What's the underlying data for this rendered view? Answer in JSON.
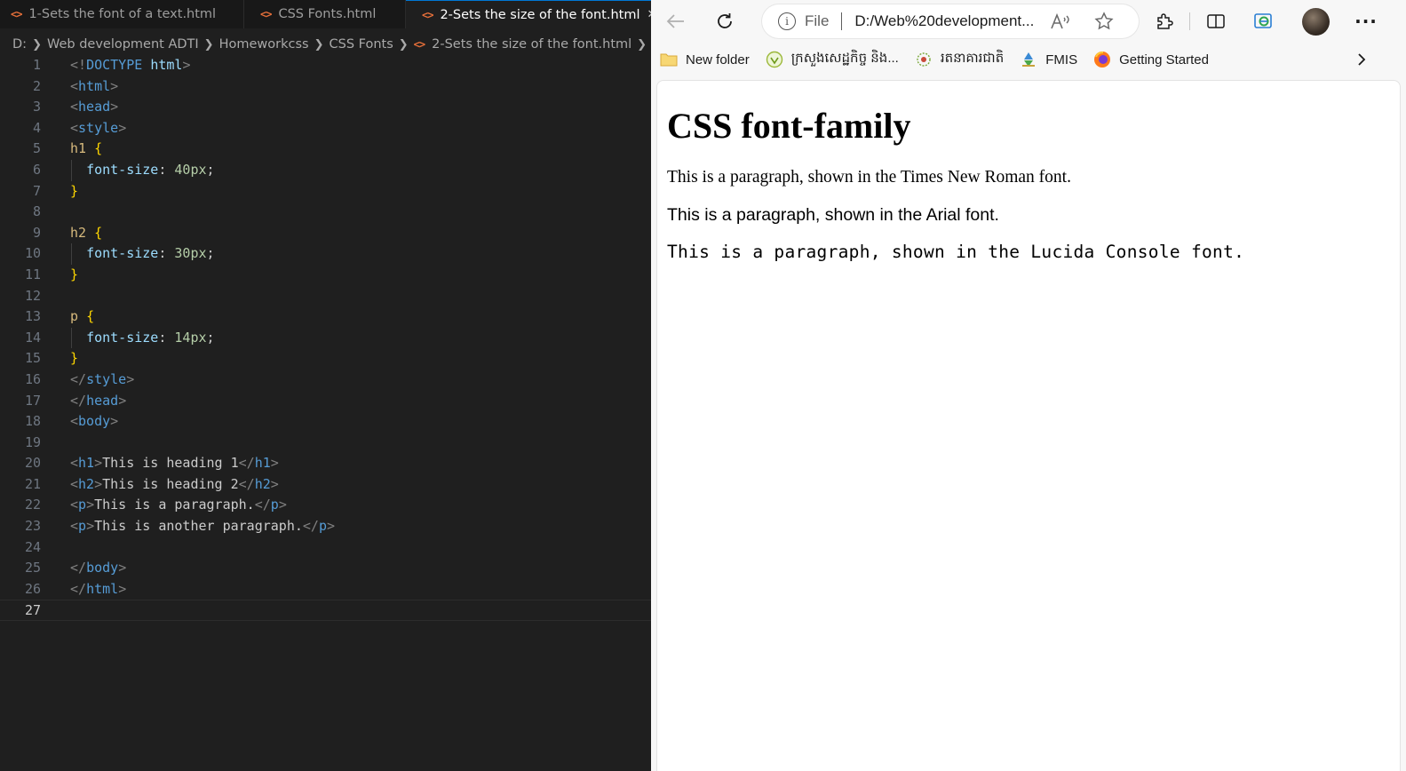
{
  "editor": {
    "tabs": [
      {
        "label": "1-Sets the font of a text.html",
        "icon": "html-file-icon"
      },
      {
        "label": "CSS Fonts.html",
        "icon": "html-file-icon"
      },
      {
        "label": "2-Sets the size of the font.html",
        "icon": "html-file-icon",
        "active": true
      }
    ],
    "breadcrumb": [
      "D:",
      "Web development ADTI",
      "Homeworkcss",
      "CSS Fonts",
      "2-Sets the size of the font.html",
      "..."
    ],
    "current_line": 27,
    "lines": [
      [
        [
          "punc",
          "<!"
        ],
        [
          "tag",
          "DOCTYPE"
        ],
        [
          "text",
          " "
        ],
        [
          "prop",
          "html"
        ],
        [
          "punc",
          ">"
        ]
      ],
      [
        [
          "punc",
          "<"
        ],
        [
          "tag",
          "html"
        ],
        [
          "punc",
          ">"
        ]
      ],
      [
        [
          "punc",
          "<"
        ],
        [
          "tag",
          "head"
        ],
        [
          "punc",
          ">"
        ]
      ],
      [
        [
          "punc",
          "<"
        ],
        [
          "tag",
          "style"
        ],
        [
          "punc",
          ">"
        ]
      ],
      [
        [
          "sel",
          "h1"
        ],
        [
          "text",
          " "
        ],
        [
          "brace",
          "{"
        ]
      ],
      [
        [
          "text",
          "  "
        ],
        [
          "prop",
          "font-size"
        ],
        [
          "text",
          ": "
        ],
        [
          "num",
          "40px"
        ],
        [
          "text",
          ";"
        ]
      ],
      [
        [
          "brace",
          "}"
        ]
      ],
      [],
      [
        [
          "sel",
          "h2"
        ],
        [
          "text",
          " "
        ],
        [
          "brace",
          "{"
        ]
      ],
      [
        [
          "text",
          "  "
        ],
        [
          "prop",
          "font-size"
        ],
        [
          "text",
          ": "
        ],
        [
          "num",
          "30px"
        ],
        [
          "text",
          ";"
        ]
      ],
      [
        [
          "brace",
          "}"
        ]
      ],
      [],
      [
        [
          "sel",
          "p"
        ],
        [
          "text",
          " "
        ],
        [
          "brace",
          "{"
        ]
      ],
      [
        [
          "text",
          "  "
        ],
        [
          "prop",
          "font-size"
        ],
        [
          "text",
          ": "
        ],
        [
          "num",
          "14px"
        ],
        [
          "text",
          ";"
        ]
      ],
      [
        [
          "brace",
          "}"
        ]
      ],
      [
        [
          "punc",
          "</"
        ],
        [
          "tag",
          "style"
        ],
        [
          "punc",
          ">"
        ]
      ],
      [
        [
          "punc",
          "</"
        ],
        [
          "tag",
          "head"
        ],
        [
          "punc",
          ">"
        ]
      ],
      [
        [
          "punc",
          "<"
        ],
        [
          "tag",
          "body"
        ],
        [
          "punc",
          ">"
        ]
      ],
      [],
      [
        [
          "punc",
          "<"
        ],
        [
          "tag",
          "h1"
        ],
        [
          "punc",
          ">"
        ],
        [
          "text",
          "This is heading 1"
        ],
        [
          "punc",
          "</"
        ],
        [
          "tag",
          "h1"
        ],
        [
          "punc",
          ">"
        ]
      ],
      [
        [
          "punc",
          "<"
        ],
        [
          "tag",
          "h2"
        ],
        [
          "punc",
          ">"
        ],
        [
          "text",
          "This is heading 2"
        ],
        [
          "punc",
          "</"
        ],
        [
          "tag",
          "h2"
        ],
        [
          "punc",
          ">"
        ]
      ],
      [
        [
          "punc",
          "<"
        ],
        [
          "tag",
          "p"
        ],
        [
          "punc",
          ">"
        ],
        [
          "text",
          "This is a paragraph."
        ],
        [
          "punc",
          "</"
        ],
        [
          "tag",
          "p"
        ],
        [
          "punc",
          ">"
        ]
      ],
      [
        [
          "punc",
          "<"
        ],
        [
          "tag",
          "p"
        ],
        [
          "punc",
          ">"
        ],
        [
          "text",
          "This is another paragraph."
        ],
        [
          "punc",
          "</"
        ],
        [
          "tag",
          "p"
        ],
        [
          "punc",
          ">"
        ]
      ],
      [],
      [
        [
          "punc",
          "</"
        ],
        [
          "tag",
          "body"
        ],
        [
          "punc",
          ">"
        ]
      ],
      [
        [
          "punc",
          "</"
        ],
        [
          "tag",
          "html"
        ],
        [
          "punc",
          ">"
        ]
      ],
      []
    ]
  },
  "browser": {
    "address": {
      "scheme": "File",
      "url": "D:/Web%20development..."
    },
    "favorites": [
      {
        "label": "New folder",
        "icon": "folder-icon"
      },
      {
        "label": "ក្រសួងសេដ្ឋកិច្ច និង...",
        "icon": "ministry-seal-icon"
      },
      {
        "label": "រតនាគារជាតិ",
        "icon": "treasury-seal-icon"
      },
      {
        "label": "FMIS",
        "icon": "fmis-logo-icon"
      },
      {
        "label": "Getting Started",
        "icon": "firefox-icon"
      }
    ],
    "page": {
      "heading": "CSS font-family",
      "paragraphs": [
        "This is a paragraph, shown in the Times New Roman font.",
        "This is a paragraph, shown in the Arial font.",
        "This is a paragraph, shown in the Lucida Console font."
      ]
    }
  }
}
